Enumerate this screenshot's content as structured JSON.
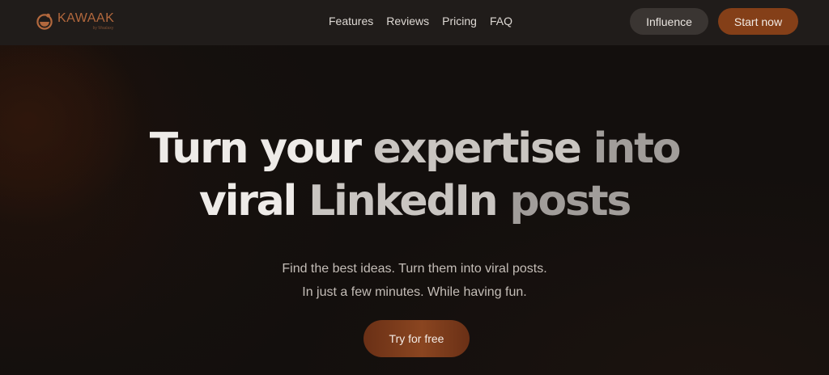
{
  "brand": {
    "name": "KAWAAK",
    "tagline": "by Waalaxy",
    "logo_icon": "kawaak-logo-icon",
    "color": "#b2683d"
  },
  "nav": {
    "links": [
      {
        "label": "Features"
      },
      {
        "label": "Reviews"
      },
      {
        "label": "Pricing"
      },
      {
        "label": "FAQ"
      }
    ],
    "influence_label": "Influence",
    "start_label": "Start now"
  },
  "hero": {
    "title_line1": {
      "part1": "Turn your ",
      "part2": "expertise ",
      "part3": "into"
    },
    "title_line2": {
      "part1": "viral ",
      "part2": "LinkedIn ",
      "part3": "posts"
    },
    "subtitle_line1": "Find the best ideas. Turn them into viral posts.",
    "subtitle_line2": "In just a few minutes. While having fun.",
    "cta_label": "Try for free"
  },
  "colors": {
    "background": "#130f0d",
    "navbar": "#201c1a",
    "accent": "#843f18",
    "secondary_button": "#3a3532"
  }
}
